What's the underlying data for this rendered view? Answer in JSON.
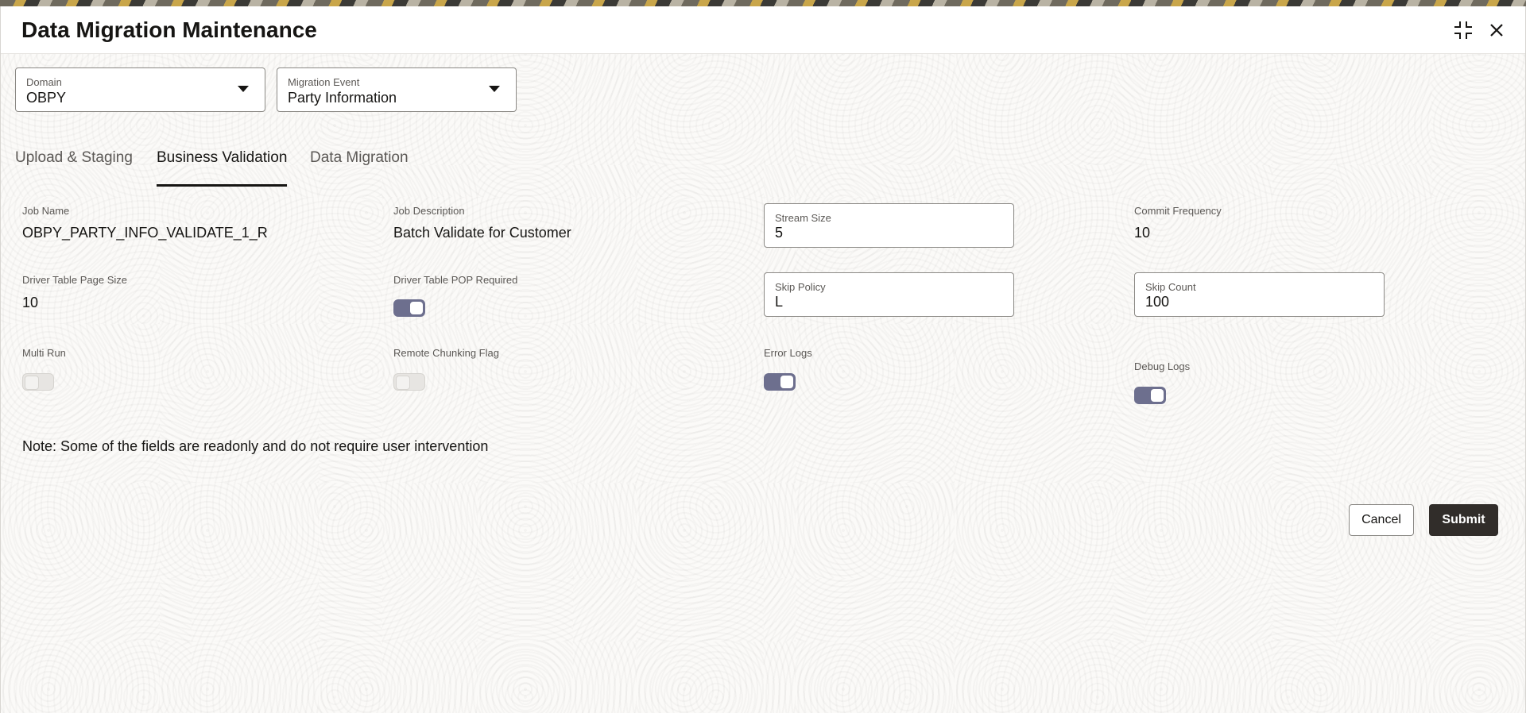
{
  "dialog": {
    "title": "Data Migration Maintenance"
  },
  "filters": {
    "domain": {
      "label": "Domain",
      "value": "OBPY"
    },
    "migration_event": {
      "label": "Migration Event",
      "value": "Party Information"
    }
  },
  "tabs": [
    {
      "label": "Upload & Staging"
    },
    {
      "label": "Business Validation"
    },
    {
      "label": "Data Migration"
    }
  ],
  "form": {
    "job_name": {
      "label": "Job Name",
      "value": "OBPY_PARTY_INFO_VALIDATE_1_R"
    },
    "job_description": {
      "label": "Job Description",
      "value": "Batch Validate for Customer"
    },
    "stream_size": {
      "label": "Stream Size",
      "value": "5"
    },
    "commit_frequency": {
      "label": "Commit Frequency",
      "value": "10"
    },
    "driver_table_page_size": {
      "label": "Driver Table Page Size",
      "value": "10"
    },
    "driver_table_pop_required": {
      "label": "Driver Table POP Required",
      "on": true
    },
    "skip_policy": {
      "label": "Skip Policy",
      "value": "L"
    },
    "skip_count": {
      "label": "Skip Count",
      "value": "100"
    },
    "multi_run": {
      "label": "Multi Run",
      "on": false
    },
    "remote_chunking_flag": {
      "label": "Remote Chunking Flag",
      "on": false
    },
    "error_logs": {
      "label": "Error Logs",
      "on": true
    },
    "debug_logs": {
      "label": "Debug Logs",
      "on": true
    }
  },
  "note": "Note: Some of the fields are readonly and do not require user intervention",
  "actions": {
    "cancel_label": "Cancel",
    "submit_label": "Submit"
  },
  "icons": {
    "minimize": "collapse-icon",
    "close": "close-icon",
    "caret": "caret-down-icon"
  },
  "colors": {
    "toggle_on": "#6d6f8e",
    "primary_button": "#312d2a",
    "text": "#161513"
  }
}
